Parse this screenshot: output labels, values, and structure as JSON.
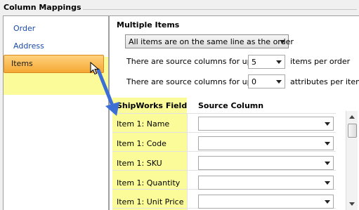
{
  "window": {
    "title": "Column Mappings"
  },
  "nav": {
    "items": [
      {
        "label": "Order"
      },
      {
        "label": "Address"
      },
      {
        "label": "Items"
      }
    ],
    "selected": "Items"
  },
  "multiple_items": {
    "title": "Multiple Items",
    "layout_select": "All items are on the same line as the order",
    "items_row": {
      "prefix": "There are source columns for up to",
      "value": "5",
      "suffix": "items per order"
    },
    "attrs_row": {
      "prefix": "There are source columns for up to",
      "value": "0",
      "suffix": "attributes per item"
    }
  },
  "grid": {
    "headers": {
      "field": "ShipWorks Field",
      "source": "Source Column"
    },
    "rows": [
      {
        "field": "Item 1: Name",
        "source": ""
      },
      {
        "field": "Item 1: Code",
        "source": ""
      },
      {
        "field": "Item 1: SKU",
        "source": ""
      },
      {
        "field": "Item 1: Quantity",
        "source": ""
      },
      {
        "field": "Item 1: Unit Price",
        "source": ""
      }
    ]
  },
  "colors": {
    "highlight": "#fbfb9a",
    "selected_item": "#f5a833",
    "annotation_arrow": "#3b6fd6",
    "link": "#1a4aa8"
  }
}
